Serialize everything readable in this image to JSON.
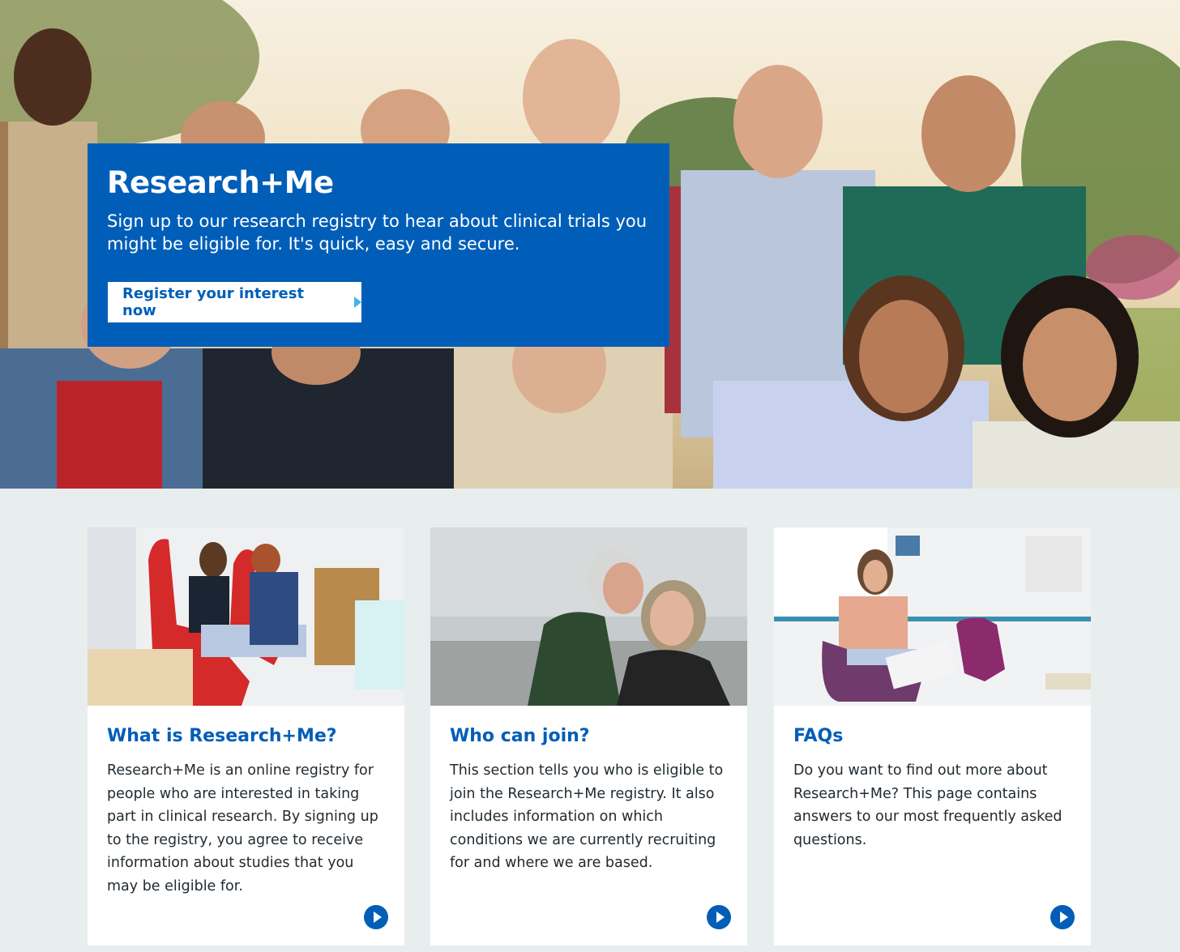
{
  "hero": {
    "image": "group-of-smiling-people-photo",
    "title": "Research+Me",
    "subtitle": "Sign up to our research registry to hear about clinical trials you might be eligible for. It's quick, easy and secure.",
    "cta_label": "Register your interest now",
    "cta_icon": "chevron-right-icon",
    "panel_color": "#005eb8"
  },
  "cards": [
    {
      "image": "patient-in-clinic-chair-photo",
      "title": "What is Research+Me?",
      "text": "Research+Me is an online registry for people who are interested in taking part in clinical research. By signing up to the registry, you agree to receive information about studies that you may be eligible for.",
      "icon": "arrow-right-circle-icon"
    },
    {
      "image": "older-couple-on-beach-photo",
      "title": "Who can join?",
      "text": "This section tells you who is eligible to join the Research+Me registry. It also includes information on which conditions we are currently recruiting for and where we are based.",
      "icon": "arrow-right-circle-icon"
    },
    {
      "image": "woman-reading-in-waiting-room-photo",
      "title": "FAQs",
      "text": "Do you want to find out more about Research+Me? This page contains answers to our most frequently asked questions.",
      "icon": "arrow-right-circle-icon"
    }
  ],
  "colors": {
    "brand_blue": "#005eb8",
    "accent_light_blue": "#41b6e6",
    "page_background": "#e8edee",
    "text": "#212b32"
  }
}
